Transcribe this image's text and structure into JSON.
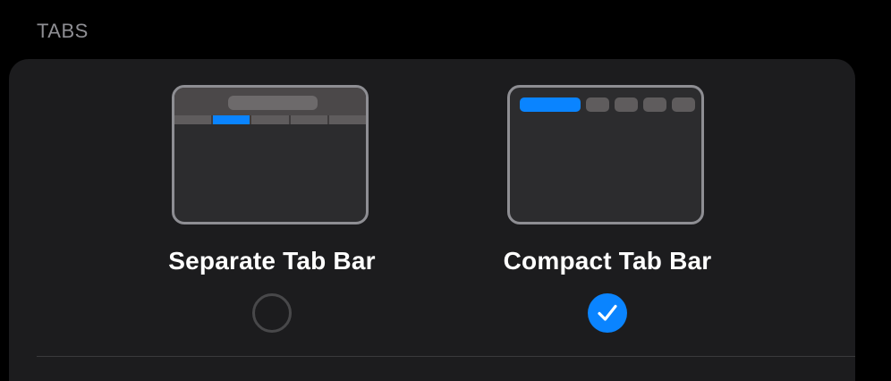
{
  "section": {
    "header": "TABS"
  },
  "options": [
    {
      "label": "Separate Tab Bar",
      "selected": false,
      "icon": "separate-tab-bar-preview-icon"
    },
    {
      "label": "Compact Tab Bar",
      "selected": true,
      "icon": "compact-tab-bar-preview-icon"
    }
  ],
  "colors": {
    "background": "#000000",
    "card": "#1c1c1e",
    "accent": "#0a84ff",
    "secondary_text": "#8e8e93",
    "primary_text": "#ffffff"
  }
}
